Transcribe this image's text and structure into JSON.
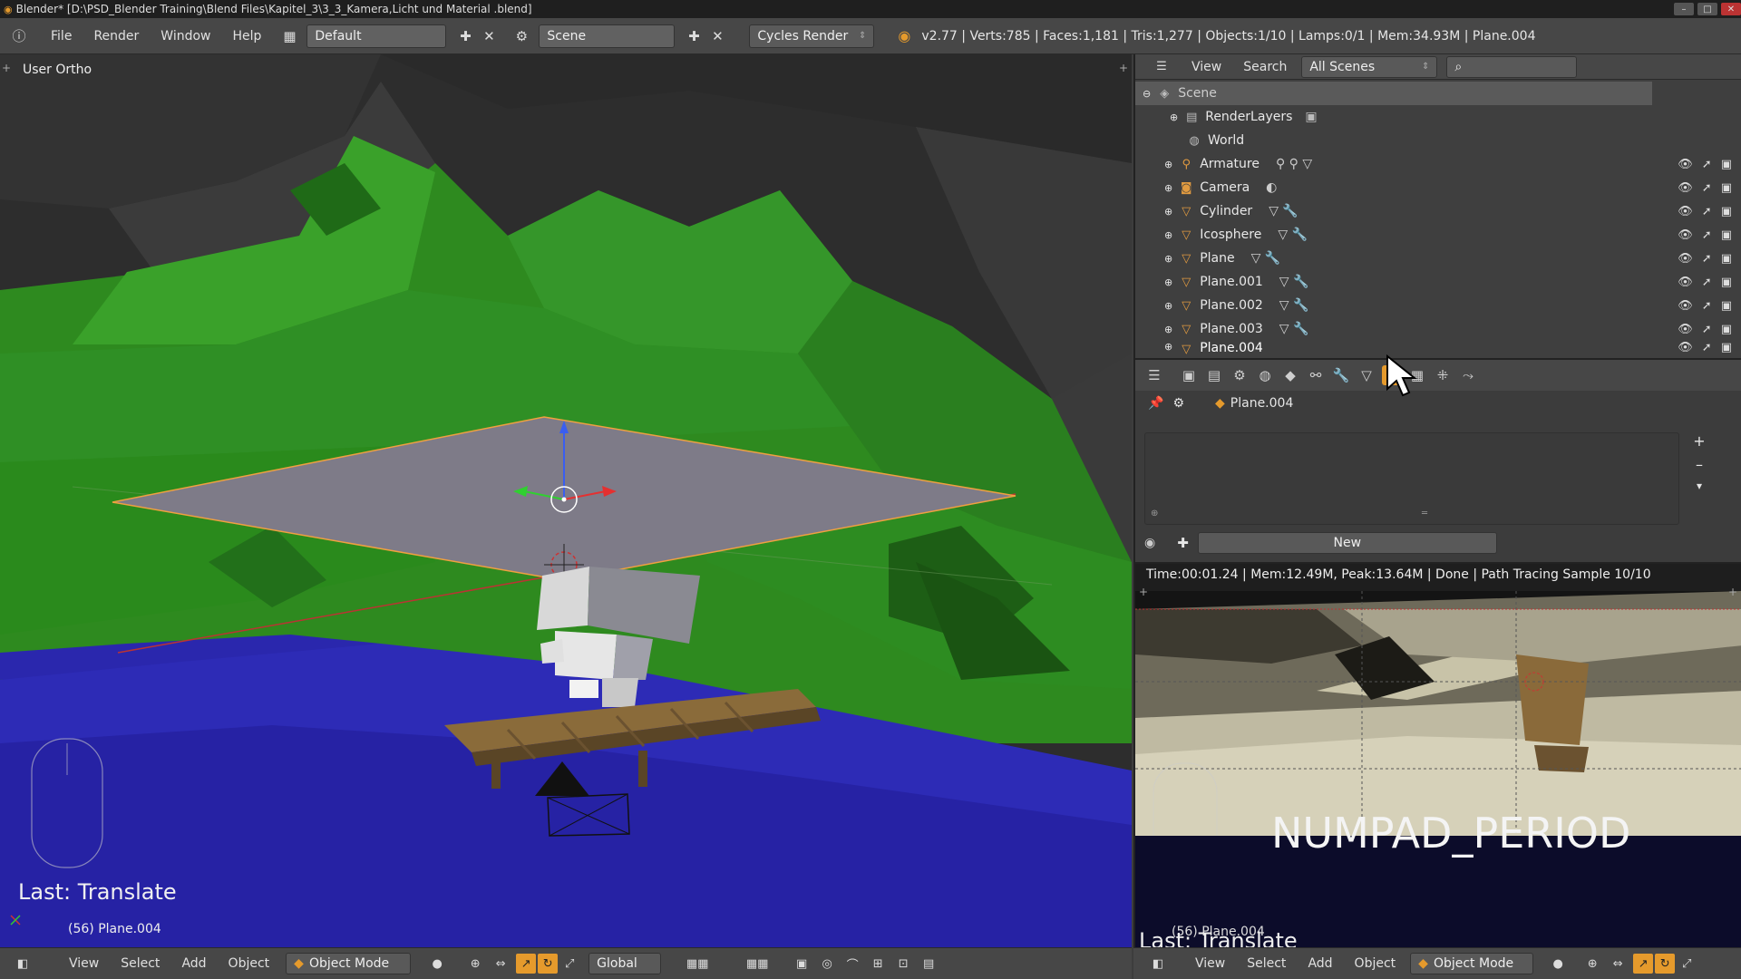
{
  "titlebar": {
    "title": "Blender* [D:\\PSD_Blender Training\\Blend Files\\Kapitel_3\\3_3_Kamera,Licht und Material .blend]"
  },
  "info": {
    "menus": [
      "File",
      "Render",
      "Window",
      "Help"
    ],
    "layout": "Default",
    "scene": "Scene",
    "engine": "Cycles Render",
    "stats": "v2.77 | Verts:785 | Faces:1,181 | Tris:1,277 | Objects:1/10 | Lamps:0/1 | Mem:34.93M | Plane.004"
  },
  "viewport": {
    "view_name": "User Ortho",
    "last_op": "Last: Translate",
    "object_info": "(56) Plane.004",
    "header": {
      "menus": [
        "View",
        "Select",
        "Add",
        "Object"
      ],
      "mode": "Object Mode",
      "orientation": "Global"
    }
  },
  "outliner": {
    "header": {
      "menus": [
        "View",
        "Search"
      ],
      "filter": "All Scenes"
    },
    "items": [
      {
        "name": "Scene",
        "icon": "scene-icon"
      },
      {
        "name": "RenderLayers",
        "icon": "renderlayers-icon"
      },
      {
        "name": "World",
        "icon": "world-icon"
      },
      {
        "name": "Armature",
        "icon": "armature-icon"
      },
      {
        "name": "Camera",
        "icon": "camera-icon"
      },
      {
        "name": "Cylinder",
        "icon": "mesh-icon"
      },
      {
        "name": "Icosphere",
        "icon": "mesh-icon"
      },
      {
        "name": "Plane",
        "icon": "mesh-icon"
      },
      {
        "name": "Plane.001",
        "icon": "mesh-icon"
      },
      {
        "name": "Plane.002",
        "icon": "mesh-icon"
      },
      {
        "name": "Plane.003",
        "icon": "mesh-icon"
      },
      {
        "name": "Plane.004",
        "icon": "mesh-icon"
      }
    ]
  },
  "properties": {
    "object": "Plane.004",
    "new_button": "New"
  },
  "render": {
    "status": "Time:00:01.24 | Mem:12.49M, Peak:13.64M | Done | Path Tracing Sample 10/10",
    "overlay": "NUMPAD_PERIOD",
    "object_info": "(56) Plane.004",
    "last_op": "Last: Translate",
    "header": {
      "menus": [
        "View",
        "Select",
        "Add",
        "Object"
      ],
      "mode": "Object Mode"
    }
  }
}
